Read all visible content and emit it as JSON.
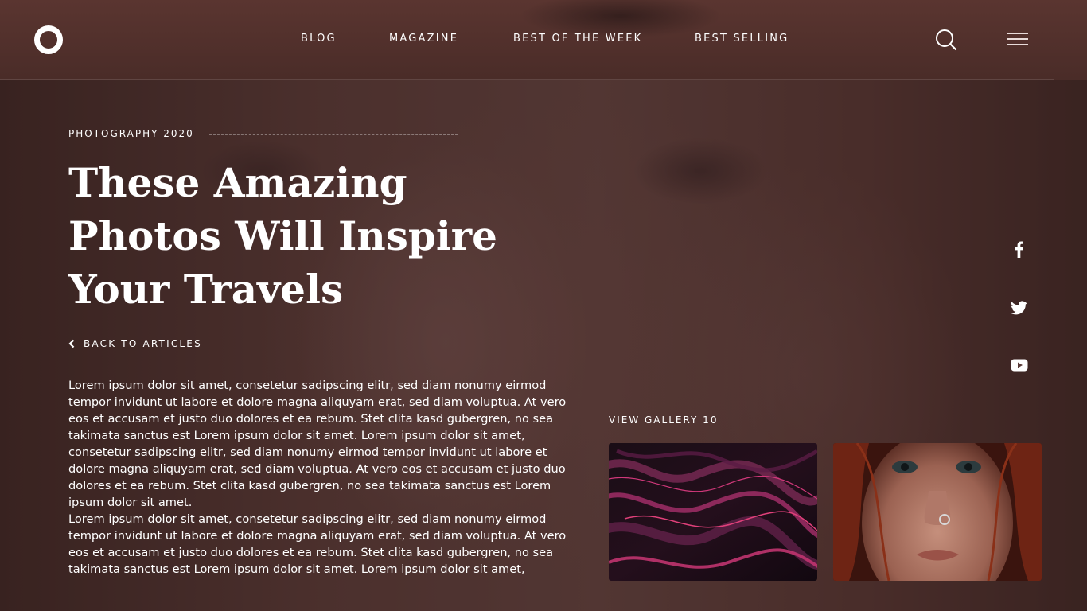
{
  "nav": {
    "items": [
      {
        "label": "BLOG"
      },
      {
        "label": "MAGAZINE"
      },
      {
        "label": "BEST OF THE WEEK"
      },
      {
        "label": "BEST SELLING"
      }
    ],
    "icons": {
      "logo": "ring-logo-icon",
      "search": "search-icon",
      "menu": "hamburger-menu-icon"
    }
  },
  "article": {
    "category": "PHOTOGRAPHY 2020",
    "title_lines": [
      "These Amazing",
      "Photos Will Inspire",
      "Your Travels"
    ],
    "back_label": "BACK TO ARTICLES",
    "paragraphs": [
      "Lorem ipsum dolor sit amet, consetetur sadipscing elitr, sed diam nonumy eirmod tempor invidunt ut labore et dolore magna aliquyam erat, sed diam voluptua. At vero eos et accusam et justo duo dolores et ea rebum. Stet clita kasd gubergren, no sea takimata sanctus est Lorem ipsum dolor sit amet. Lorem ipsum dolor sit amet, consetetur sadipscing elitr, sed diam nonumy eirmod tempor invidunt ut labore et dolore magna aliquyam erat, sed diam voluptua. At vero eos et accusam et justo duo dolores et ea rebum. Stet clita kasd gubergren, no sea takimata sanctus est Lorem ipsum dolor sit amet.",
      "Lorem ipsum dolor sit amet, consetetur sadipscing elitr, sed diam nonumy eirmod tempor invidunt ut labore et dolore magna aliquyam erat, sed diam voluptua. At vero eos et accusam et justo duo dolores et ea rebum. Stet clita kasd gubergren, no sea takimata sanctus est Lorem ipsum dolor sit amet. Lorem ipsum dolor sit amet,"
    ]
  },
  "social": [
    "facebook-icon",
    "twitter-icon",
    "youtube-icon"
  ],
  "gallery": {
    "label": "VIEW GALLERY 10",
    "thumbnails": [
      "abstract-marble-thumbnail",
      "freckled-portrait-thumbnail"
    ]
  },
  "colors": {
    "text": "#ffffff",
    "background": "#5a3b38",
    "header": "#4a2c28"
  }
}
